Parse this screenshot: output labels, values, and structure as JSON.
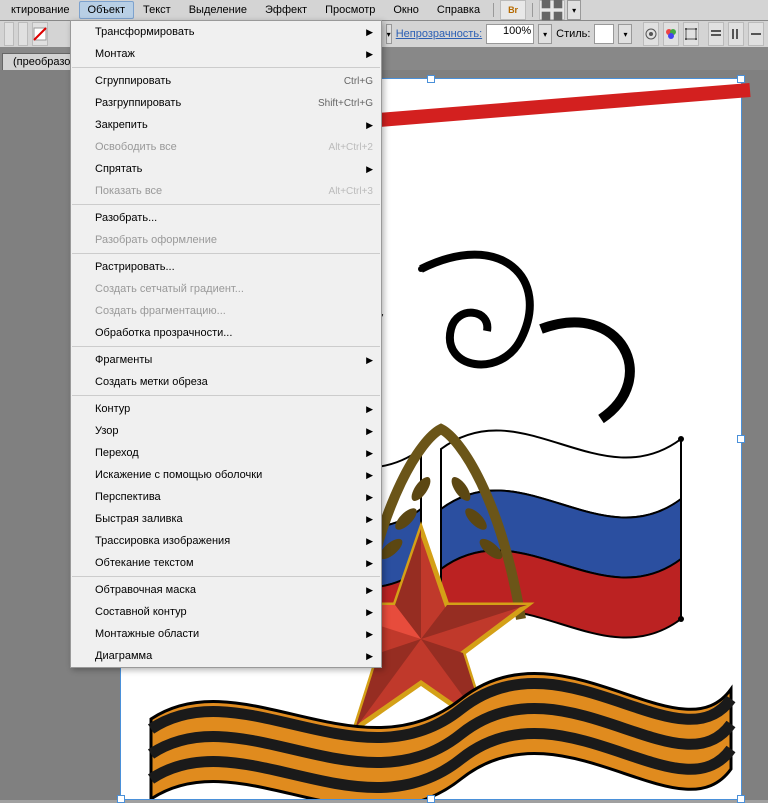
{
  "menubar": {
    "items": [
      {
        "label": "ктирование"
      },
      {
        "label": "Объект"
      },
      {
        "label": "Текст"
      },
      {
        "label": "Выделение"
      },
      {
        "label": "Эффект"
      },
      {
        "label": "Просмотр"
      },
      {
        "label": "Окно"
      },
      {
        "label": "Справка"
      }
    ],
    "br_badge": "Br"
  },
  "toolbar": {
    "opacity_label": "Непрозрачность:",
    "opacity_value": "100%",
    "style_label": "Стиль:"
  },
  "tab": {
    "title": "(преобразова"
  },
  "dropdown": {
    "groups": [
      [
        {
          "label": "Трансформировать",
          "sub": true
        },
        {
          "label": "Монтаж",
          "sub": true
        }
      ],
      [
        {
          "label": "Сгруппировать",
          "short": "Ctrl+G"
        },
        {
          "label": "Разгруппировать",
          "short": "Shift+Ctrl+G"
        },
        {
          "label": "Закрепить",
          "sub": true
        },
        {
          "label": "Освободить все",
          "short": "Alt+Ctrl+2",
          "disabled": true
        },
        {
          "label": "Спрятать",
          "sub": true
        },
        {
          "label": "Показать все",
          "short": "Alt+Ctrl+3",
          "disabled": true
        }
      ],
      [
        {
          "label": "Разобрать..."
        },
        {
          "label": "Разобрать оформление",
          "disabled": true
        }
      ],
      [
        {
          "label": "Растрировать..."
        },
        {
          "label": "Создать сетчатый градиент...",
          "disabled": true
        },
        {
          "label": "Создать фрагментацию...",
          "disabled": true
        },
        {
          "label": "Обработка прозрачности..."
        }
      ],
      [
        {
          "label": "Фрагменты",
          "sub": true
        },
        {
          "label": "Создать метки обреза"
        }
      ],
      [
        {
          "label": "Контур",
          "sub": true
        },
        {
          "label": "Узор",
          "sub": true
        },
        {
          "label": "Переход",
          "sub": true
        },
        {
          "label": "Искажение с помощью оболочки",
          "sub": true
        },
        {
          "label": "Перспектива",
          "sub": true
        },
        {
          "label": "Быстрая заливка",
          "sub": true
        },
        {
          "label": "Трассировка изображения",
          "sub": true
        },
        {
          "label": "Обтекание текстом",
          "sub": true
        }
      ],
      [
        {
          "label": "Обтравочная маска",
          "sub": true
        },
        {
          "label": "Составной контур",
          "sub": true
        },
        {
          "label": "Монтажные области",
          "sub": true
        },
        {
          "label": "Диаграмма",
          "sub": true
        }
      ]
    ]
  }
}
